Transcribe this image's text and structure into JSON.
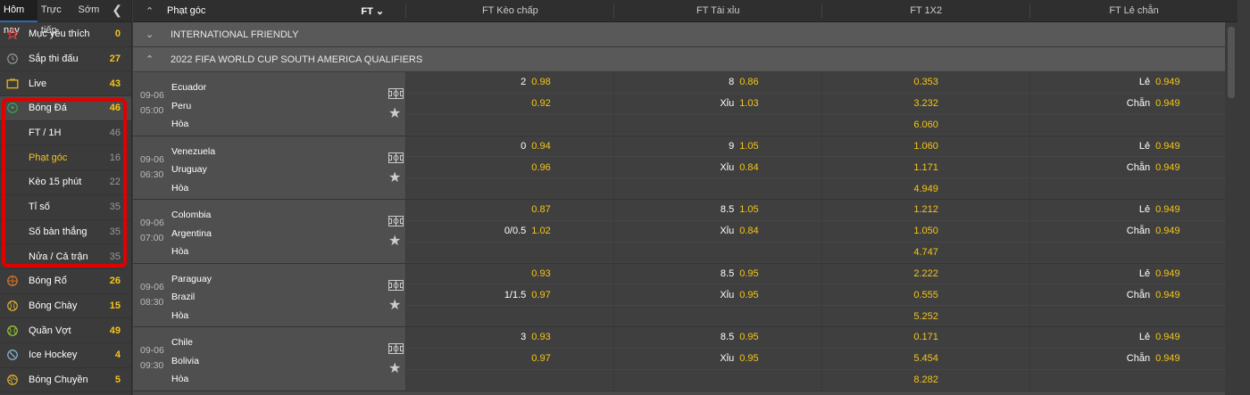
{
  "sidebar": {
    "tabs": [
      "Hôm nay",
      "Trực tiếp",
      "Sớm"
    ],
    "items": [
      {
        "label": "Mục yêu thích",
        "count": "0",
        "icon": "star-icon"
      },
      {
        "label": "Sắp thi đấu",
        "count": "27",
        "icon": "clock-icon"
      },
      {
        "label": "Live",
        "count": "43",
        "icon": "tv-icon"
      },
      {
        "label": "Bóng Đá",
        "count": "46",
        "icon": "soccer-ball-icon"
      }
    ],
    "subitems": [
      {
        "label": "FT / 1H",
        "count": "46"
      },
      {
        "label": "Phạt góc",
        "count": "16"
      },
      {
        "label": "Kèo 15 phút",
        "count": "22"
      },
      {
        "label": "Tỉ số",
        "count": "35"
      },
      {
        "label": "Số bàn thắng",
        "count": "35"
      },
      {
        "label": "Nửa / Cả trận",
        "count": "35"
      }
    ],
    "items2": [
      {
        "label": "Bóng Rổ",
        "count": "26",
        "icon": "basketball-icon"
      },
      {
        "label": "Bóng Chày",
        "count": "15",
        "icon": "baseball-icon"
      },
      {
        "label": "Quần Vợt",
        "count": "49",
        "icon": "tennis-icon"
      },
      {
        "label": "Ice Hockey",
        "count": "4",
        "icon": "hockey-icon"
      },
      {
        "label": "Bóng Chuyền",
        "count": "5",
        "icon": "volleyball-icon"
      }
    ]
  },
  "header": {
    "market": "Phạt góc",
    "period": "FT",
    "cols": [
      "FT Kèo chấp",
      "FT Tài xỉu",
      "FT 1X2",
      "FT Lẻ chẵn"
    ]
  },
  "leagues": [
    "INTERNATIONAL FRIENDLY",
    "2022 FIFA WORLD CUP SOUTH AMERICA QUALIFIERS"
  ],
  "matches": [
    {
      "date": "09-06",
      "time": "05:00",
      "home": "Ecuador",
      "away": "Peru",
      "draw": "Hòa",
      "hcp": [
        [
          "2",
          "0.98"
        ],
        [
          "",
          "0.92"
        ],
        [
          "",
          ""
        ]
      ],
      "ou": [
        [
          "8",
          "0.86"
        ],
        [
          "Xỉu",
          "1.03"
        ],
        [
          "",
          ""
        ]
      ],
      "x12": [
        "0.353",
        "3.232",
        "6.060"
      ],
      "oe": [
        [
          "Lẻ",
          "0.949"
        ],
        [
          "Chẵn",
          "0.949"
        ],
        [
          "",
          ""
        ]
      ]
    },
    {
      "date": "09-06",
      "time": "06:30",
      "home": "Venezuela",
      "away": "Uruguay",
      "draw": "Hòa",
      "hcp": [
        [
          "0",
          "0.94"
        ],
        [
          "",
          "0.96"
        ],
        [
          "",
          ""
        ]
      ],
      "ou": [
        [
          "9",
          "1.05"
        ],
        [
          "Xỉu",
          "0.84"
        ],
        [
          "",
          ""
        ]
      ],
      "x12": [
        "1.060",
        "1.171",
        "4.949"
      ],
      "oe": [
        [
          "Lẻ",
          "0.949"
        ],
        [
          "Chẵn",
          "0.949"
        ],
        [
          "",
          ""
        ]
      ]
    },
    {
      "date": "09-06",
      "time": "07:00",
      "home": "Colombia",
      "away": "Argentina",
      "draw": "Hòa",
      "hcp": [
        [
          "",
          "0.87"
        ],
        [
          "0/0.5",
          "1.02"
        ],
        [
          "",
          ""
        ]
      ],
      "ou": [
        [
          "8.5",
          "1.05"
        ],
        [
          "Xỉu",
          "0.84"
        ],
        [
          "",
          ""
        ]
      ],
      "x12": [
        "1.212",
        "1.050",
        "4.747"
      ],
      "oe": [
        [
          "Lẻ",
          "0.949"
        ],
        [
          "Chẵn",
          "0.949"
        ],
        [
          "",
          ""
        ]
      ]
    },
    {
      "date": "09-06",
      "time": "08:30",
      "home": "Paraguay",
      "away": "Brazil",
      "draw": "Hòa",
      "hcp": [
        [
          "",
          "0.93"
        ],
        [
          "1/1.5",
          "0.97"
        ],
        [
          "",
          ""
        ]
      ],
      "ou": [
        [
          "8.5",
          "0.95"
        ],
        [
          "Xỉu",
          "0.95"
        ],
        [
          "",
          ""
        ]
      ],
      "x12": [
        "2.222",
        "0.555",
        "5.252"
      ],
      "oe": [
        [
          "Lẻ",
          "0.949"
        ],
        [
          "Chẵn",
          "0.949"
        ],
        [
          "",
          ""
        ]
      ]
    },
    {
      "date": "09-06",
      "time": "09:30",
      "home": "Chile",
      "away": "Bolivia",
      "draw": "Hòa",
      "hcp": [
        [
          "3",
          "0.93"
        ],
        [
          "",
          "0.97"
        ],
        [
          "",
          ""
        ]
      ],
      "ou": [
        [
          "8.5",
          "0.95"
        ],
        [
          "Xỉu",
          "0.95"
        ],
        [
          "",
          ""
        ]
      ],
      "x12": [
        "0.171",
        "5.454",
        "8.282"
      ],
      "oe": [
        [
          "Lẻ",
          "0.949"
        ],
        [
          "Chẵn",
          "0.949"
        ],
        [
          "",
          ""
        ]
      ]
    }
  ],
  "colors": {
    "accent": "#f5c518",
    "highlight_box": "#e00000",
    "tab_active": "#2b6cb0"
  }
}
